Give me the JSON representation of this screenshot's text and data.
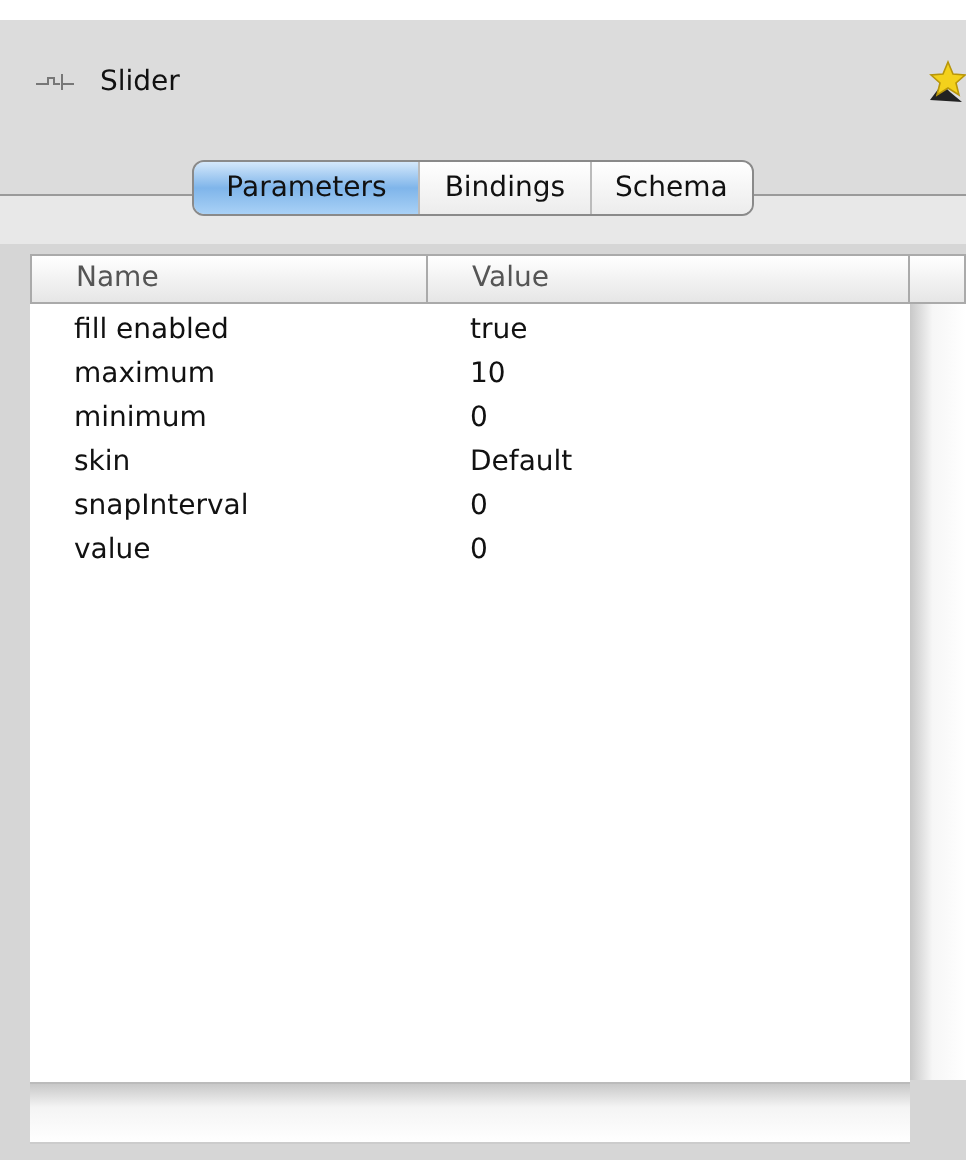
{
  "panel": {
    "title": "Slider"
  },
  "tabs": [
    {
      "label": "Parameters",
      "selected": true
    },
    {
      "label": "Bindings",
      "selected": false
    },
    {
      "label": "Schema",
      "selected": false
    }
  ],
  "table": {
    "columns": [
      "Name",
      "Value"
    ],
    "rows": [
      {
        "name": "fill enabled",
        "value": "true"
      },
      {
        "name": "maximum",
        "value": "10"
      },
      {
        "name": "minimum",
        "value": "0"
      },
      {
        "name": "skin",
        "value": "Default"
      },
      {
        "name": "snapInterval",
        "value": "0"
      },
      {
        "name": "value",
        "value": "0"
      }
    ]
  }
}
